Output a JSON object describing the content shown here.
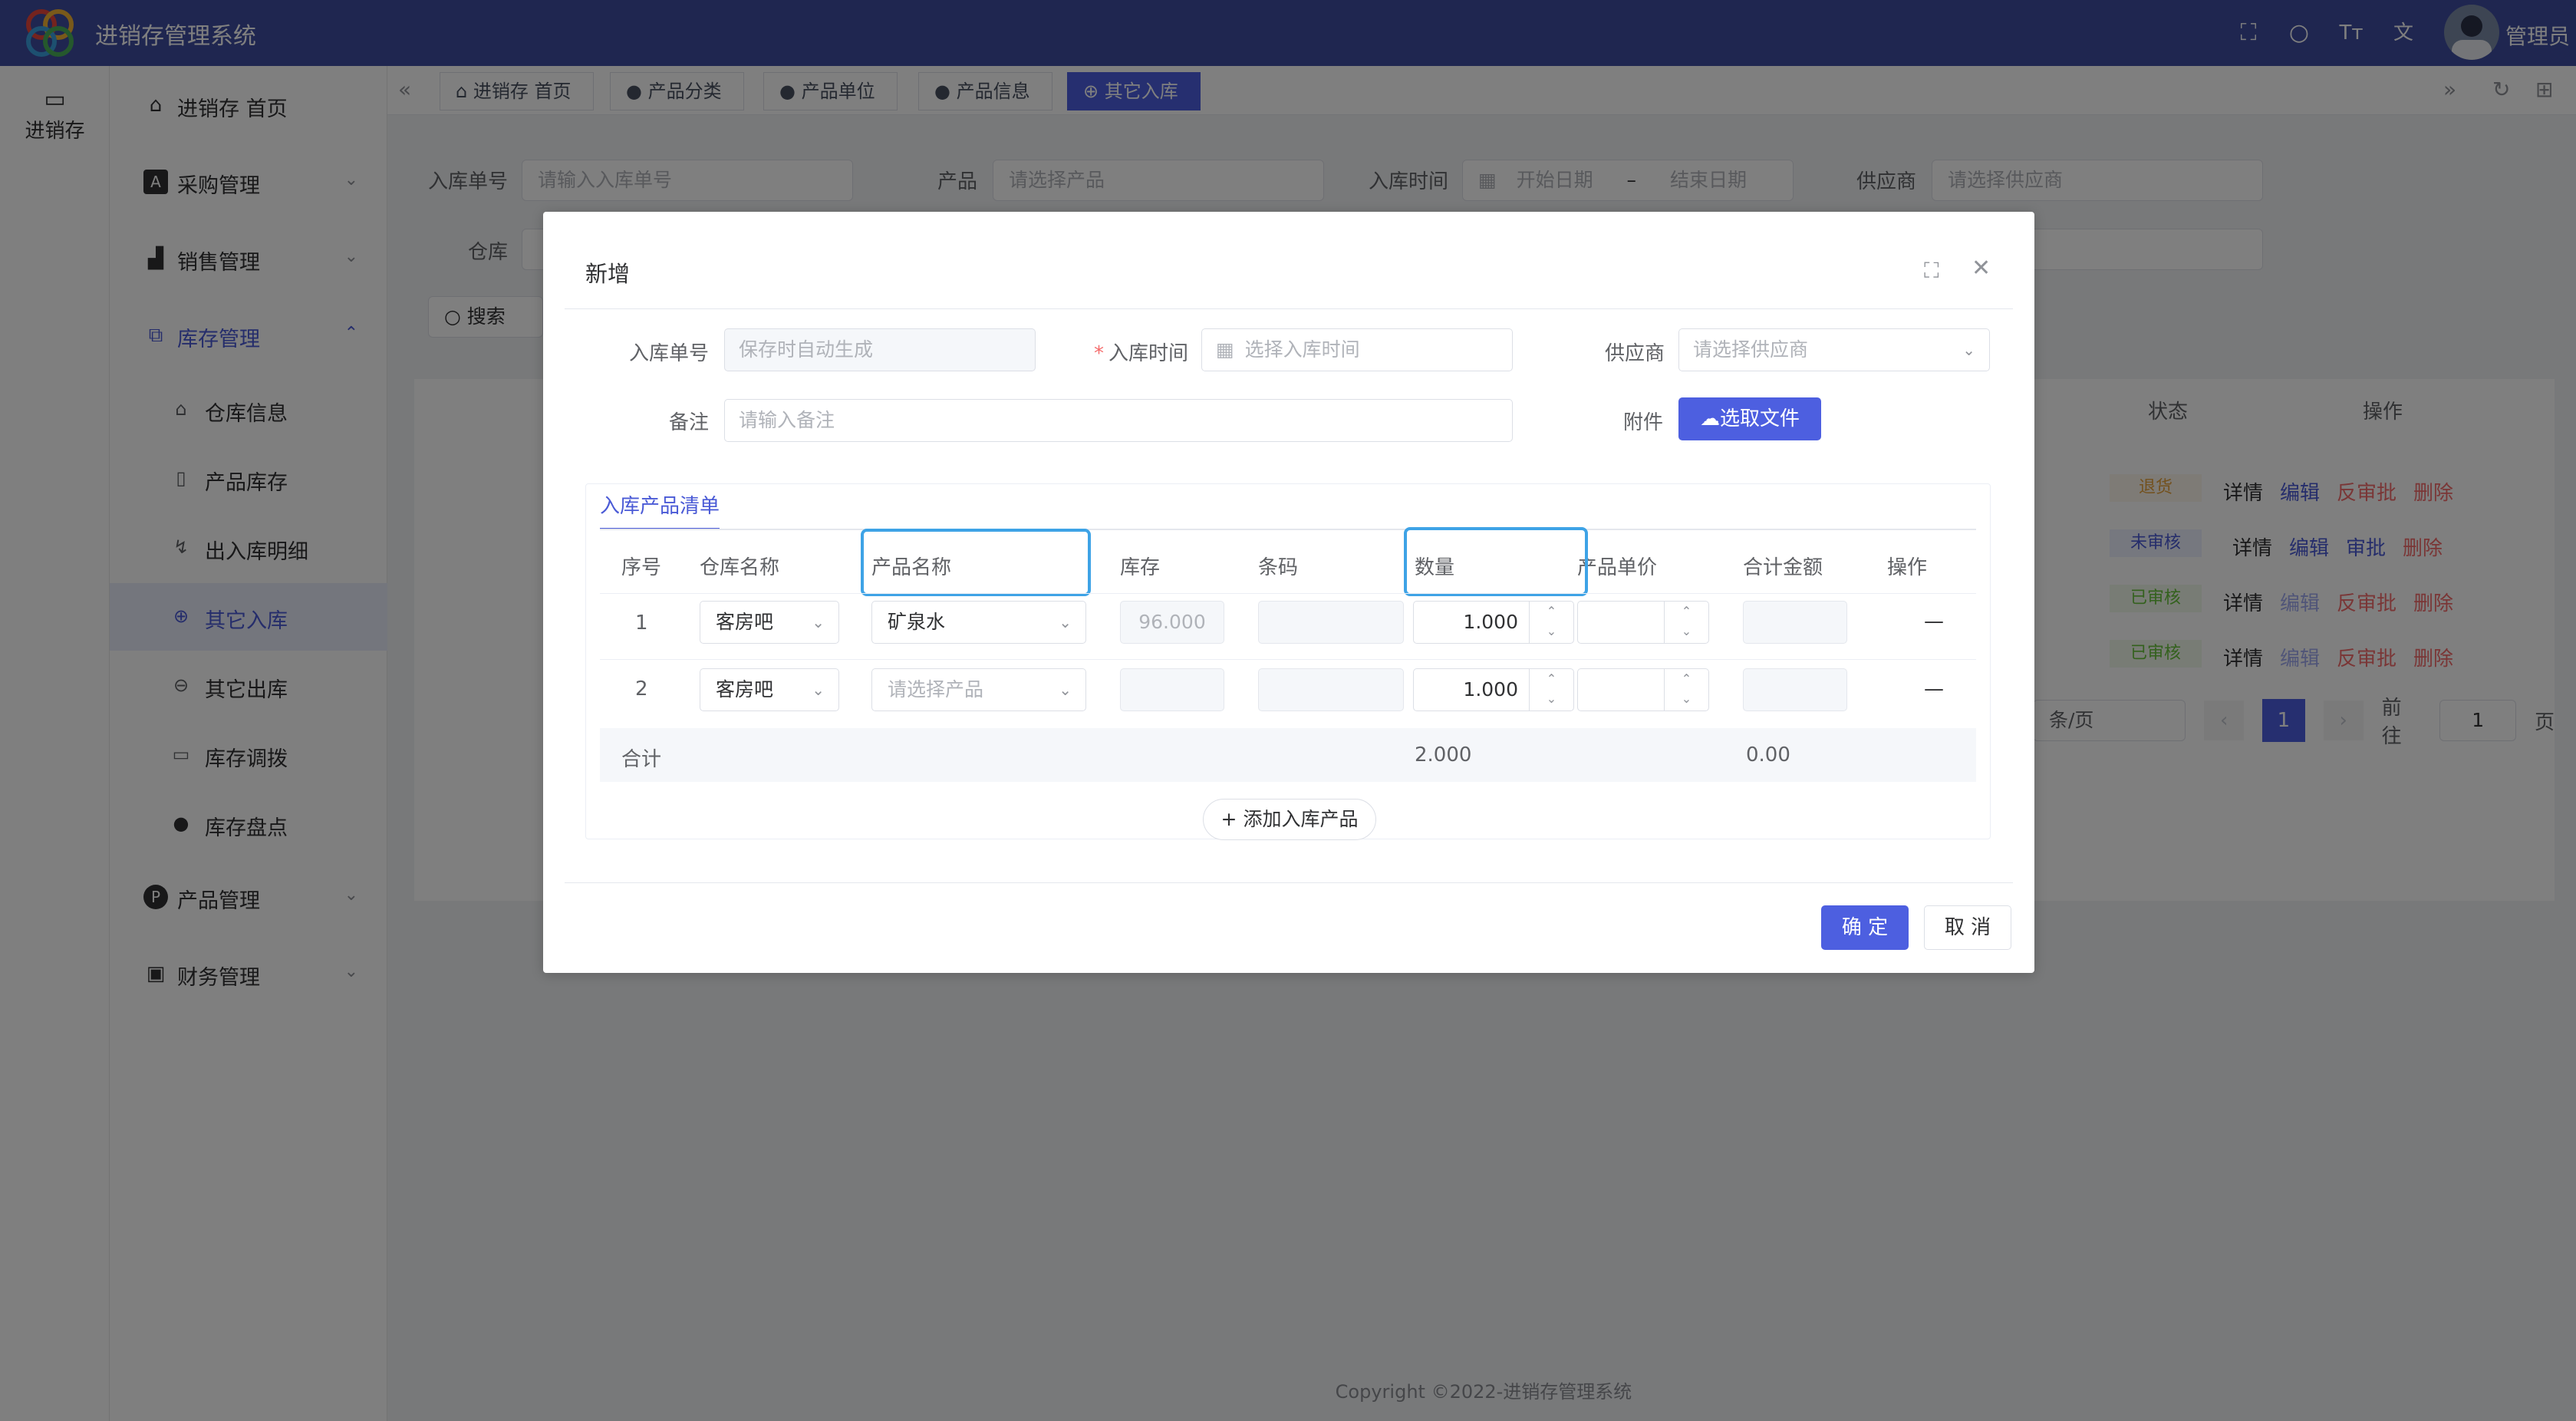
{
  "app": {
    "title": "进销存管理系统",
    "user": "管理员",
    "module": "进销存"
  },
  "colors": {
    "primary": "#4d5fe0",
    "header": "#3f4da1",
    "highlight": "#3ea3e6",
    "danger": "#f56c6c",
    "success": "#67c23a",
    "warning": "#e6a23c"
  },
  "header_icons": [
    "fullscreen-icon",
    "search-icon",
    "font-size-icon",
    "translate-icon"
  ],
  "sidebar": {
    "items": [
      {
        "label": "进销存 首页",
        "icon": "home-icon"
      },
      {
        "label": "采购管理",
        "icon": "purchase-icon"
      },
      {
        "label": "销售管理",
        "icon": "sales-icon"
      },
      {
        "label": "库存管理",
        "icon": "inventory-icon"
      },
      {
        "label": "产品管理",
        "icon": "product-icon"
      },
      {
        "label": "财务管理",
        "icon": "finance-icon"
      }
    ],
    "sub_items": [
      {
        "label": "仓库信息",
        "icon": "warehouse-icon"
      },
      {
        "label": "产品库存",
        "icon": "stock-icon"
      },
      {
        "label": "出入库明细",
        "icon": "detail-icon"
      },
      {
        "label": "其它入库",
        "icon": "inbound-icon"
      },
      {
        "label": "其它出库",
        "icon": "outbound-icon"
      },
      {
        "label": "库存调拨",
        "icon": "transfer-icon"
      },
      {
        "label": "库存盘点",
        "icon": "check-icon"
      }
    ]
  },
  "tabs": [
    "进销存 首页",
    "产品分类",
    "产品单位",
    "产品信息",
    "其它入库"
  ],
  "filters": {
    "order_no_label": "入库单号",
    "order_no_placeholder": "请输入入库单号",
    "product_label": "产品",
    "product_placeholder": "请选择产品",
    "time_label": "入库时间",
    "start_placeholder": "开始日期",
    "range_sep": "–",
    "end_placeholder": "结束日期",
    "supplier_label": "供应商",
    "supplier_placeholder": "请选择供应商",
    "warehouse_label": "仓库",
    "search_btn": "搜索"
  },
  "bg_table": {
    "status_header": "状态",
    "action_header": "操作",
    "rows": [
      {
        "status": "退货",
        "actions": [
          "详情",
          "编辑",
          "反审批",
          "删除"
        ]
      },
      {
        "status": "未审核",
        "actions": [
          "详情",
          "编辑",
          "审批",
          "删除"
        ]
      },
      {
        "status": "已审核",
        "actions": [
          "详情",
          "编辑",
          "反审批",
          "删除"
        ]
      },
      {
        "status": "已审核",
        "actions": [
          "详情",
          "编辑",
          "反审批",
          "删除"
        ]
      }
    ],
    "pagination": {
      "page_size": "条/页",
      "current": "1",
      "goto_prefix": "前往",
      "goto_value": "1",
      "goto_suffix": "页"
    }
  },
  "dialog": {
    "title": "新增",
    "order_no_label": "入库单号",
    "order_no_placeholder": "保存时自动生成",
    "time_label": "入库时间",
    "time_placeholder": "选择入库时间",
    "supplier_label": "供应商",
    "supplier_placeholder": "请选择供应商",
    "remark_label": "备注",
    "remark_placeholder": "请输入备注",
    "attachment_label": "附件",
    "upload_btn": "选取文件",
    "section_tab": "入库产品清单",
    "columns": [
      "序号",
      "仓库名称",
      "产品名称",
      "库存",
      "条码",
      "数量",
      "产品单价",
      "合计金额",
      "操作"
    ],
    "rows": [
      {
        "index": "1",
        "warehouse": "客房吧",
        "product": "矿泉水",
        "stock": "96.000",
        "qty": "1.000",
        "op": "—"
      },
      {
        "index": "2",
        "warehouse": "客房吧",
        "product": "请选择产品",
        "stock": "",
        "qty": "1.000",
        "op": "—"
      }
    ],
    "summary": {
      "label": "合计",
      "qty_total": "2.000",
      "amount_total": "0.00"
    },
    "add_btn": "+ 添加入库产品",
    "ok_btn": "确 定",
    "cancel_btn": "取 消"
  },
  "footer": "Copyright ©2022-进销存管理系统"
}
